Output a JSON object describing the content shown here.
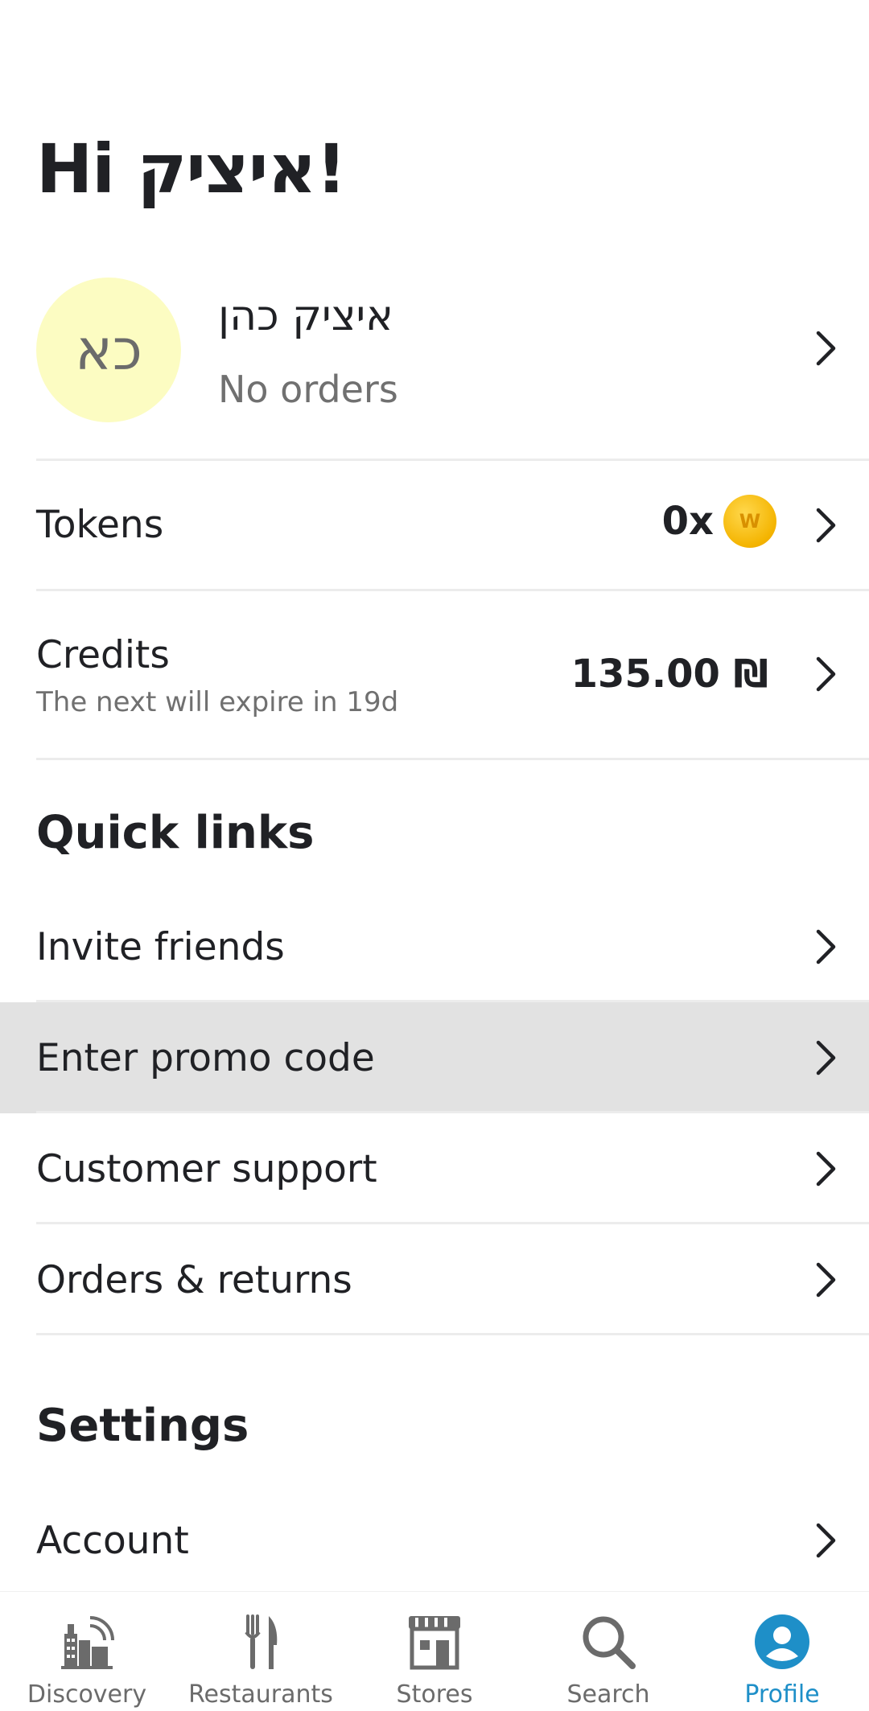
{
  "greeting": "Hi איציק!",
  "profile": {
    "initials": "כא",
    "name": "איציק כהן",
    "orders_status": "No orders"
  },
  "tokens": {
    "label": "Tokens",
    "value": "0x",
    "coin_letter": "W"
  },
  "credits": {
    "label": "Credits",
    "subtitle": "The next will expire in 19d",
    "value": "135.00 ₪"
  },
  "quick_links": {
    "title": "Quick links",
    "items": [
      {
        "label": "Invite friends"
      },
      {
        "label": "Enter promo code"
      },
      {
        "label": "Customer support"
      },
      {
        "label": "Orders & returns"
      }
    ]
  },
  "settings": {
    "title": "Settings",
    "items": [
      {
        "label": "Account"
      }
    ]
  },
  "bottom_nav": {
    "items": [
      {
        "label": "Discovery",
        "icon": "discovery-icon"
      },
      {
        "label": "Restaurants",
        "icon": "fork-knife-icon"
      },
      {
        "label": "Stores",
        "icon": "store-icon"
      },
      {
        "label": "Search",
        "icon": "search-icon"
      },
      {
        "label": "Profile",
        "icon": "profile-icon"
      }
    ],
    "active": "Profile"
  },
  "colors": {
    "accent": "#1e8fc8",
    "avatar_bg": "#fcfcc2",
    "highlight_row": "#e2e2e2",
    "coin": "#f4b400"
  }
}
